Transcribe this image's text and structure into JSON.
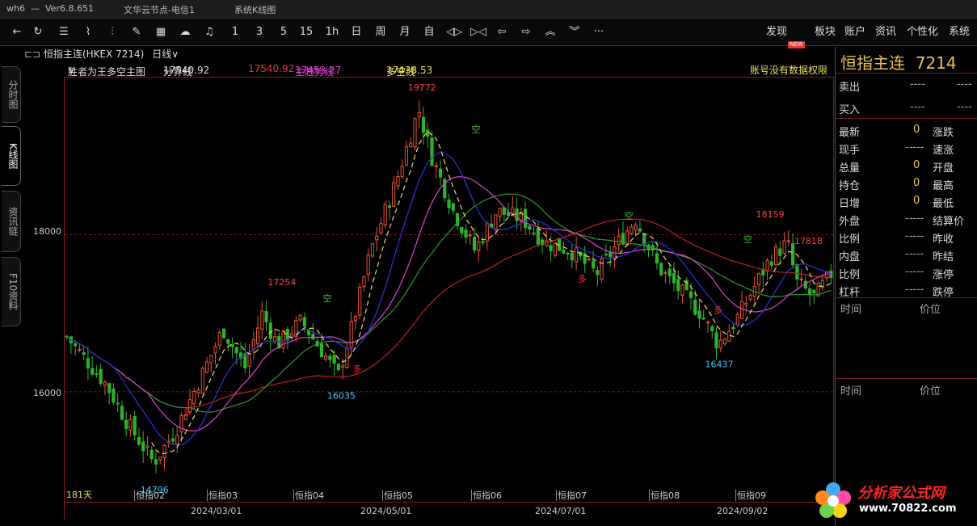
{
  "titlebar": {
    "app": "wh6",
    "dash": "—",
    "version": "Ver6.8.651",
    "server": "文华云节点-电信1",
    "window": "系统K线图"
  },
  "toolbar": {
    "periods": [
      "1",
      "3",
      "5",
      "15",
      "1h",
      "日",
      "周",
      "月",
      "自"
    ],
    "right_menu": [
      "发现",
      "板块",
      "账户",
      "资讯",
      "个性化",
      "系统"
    ],
    "new_badge": "NEW",
    "more": "···"
  },
  "sidetabs": [
    "分时图",
    "K线图",
    "资讯链",
    "F10资料"
  ],
  "chart_header": {
    "instrument": "恒指主连(HKEX 7214)",
    "period": "日线",
    "period_arrow": "∨"
  },
  "indicator": {
    "name": "胜者为王多空主图",
    "arrow": "∨",
    "items": [
      {
        "label": "分界线",
        "value": "17540.92",
        "color": "#dddddd"
      },
      {
        "label": "",
        "value": "17540.92",
        "color": "#e23a3a"
      },
      {
        "label": "主趋势线",
        "value": "17453.27",
        "color": "#e040d0"
      },
      {
        "label": "多空线",
        "value": "17438.53",
        "color": "#e8e05a"
      }
    ],
    "notice": "账号没有数据权限"
  },
  "axis": {
    "y_labels": [
      "18000",
      "16000"
    ],
    "x_month_labels": [
      "恒指02",
      "恒指03",
      "恒指04",
      "恒指05",
      "恒指06",
      "恒指07",
      "恒指08",
      "恒指09"
    ],
    "x_date_labels": [
      "2024/03/01",
      "2024/05/01",
      "2024/07/01",
      "2024/09/02"
    ],
    "days": "181天"
  },
  "chart_data": {
    "type": "candlestick",
    "ylim": [
      14600,
      20000
    ],
    "annotations": {
      "highs": [
        "17254",
        "19772",
        "18159",
        "17818"
      ],
      "lows": [
        "14796",
        "16035",
        "16437"
      ],
      "long": "多",
      "short": "空"
    },
    "colors": {
      "up": "#e8532f",
      "down": "#2bb52b",
      "ma_short": "#e8e05a",
      "ma_mid": "#e040d0",
      "ma_blue": "#3030e0",
      "ma_long": "#c02020",
      "ma_green": "#2a9a2a",
      "stop_long": "#e02020",
      "stop_short": "#2aa02a"
    }
  },
  "right_panel": {
    "title": "恒指主连",
    "code": "7214",
    "ask": {
      "label": "卖出",
      "price": "----",
      "vol": "----"
    },
    "bid": {
      "label": "买入",
      "price": "----",
      "vol": "----"
    },
    "rows": [
      {
        "k": "最新",
        "v": "0",
        "k2": "涨跌",
        "v2": ""
      },
      {
        "k": "现手",
        "v": "-----",
        "k2": "速涨",
        "v2": ""
      },
      {
        "k": "总量",
        "v": "0",
        "k2": "开盘",
        "v2": ""
      },
      {
        "k": "持仓",
        "v": "0",
        "k2": "最高",
        "v2": ""
      },
      {
        "k": "日增",
        "v": "0",
        "k2": "最低",
        "v2": ""
      },
      {
        "k": "外盘",
        "v": "-----",
        "k2": "结算价",
        "v2": ""
      },
      {
        "k": "比例",
        "v": "-----",
        "k2": "昨收",
        "v2": ""
      },
      {
        "k": "内盘",
        "v": "-----",
        "k2": "昨结",
        "v2": ""
      },
      {
        "k": "比例",
        "v": "-----",
        "k2": "涨停",
        "v2": ""
      },
      {
        "k": "杠杆",
        "v": "-----",
        "k2": "跌停",
        "v2": ""
      }
    ],
    "ticks_head": {
      "time": "时间",
      "price": "价位"
    }
  },
  "logo": {
    "name": "分析家公式网",
    "url": "www.70822.com"
  }
}
